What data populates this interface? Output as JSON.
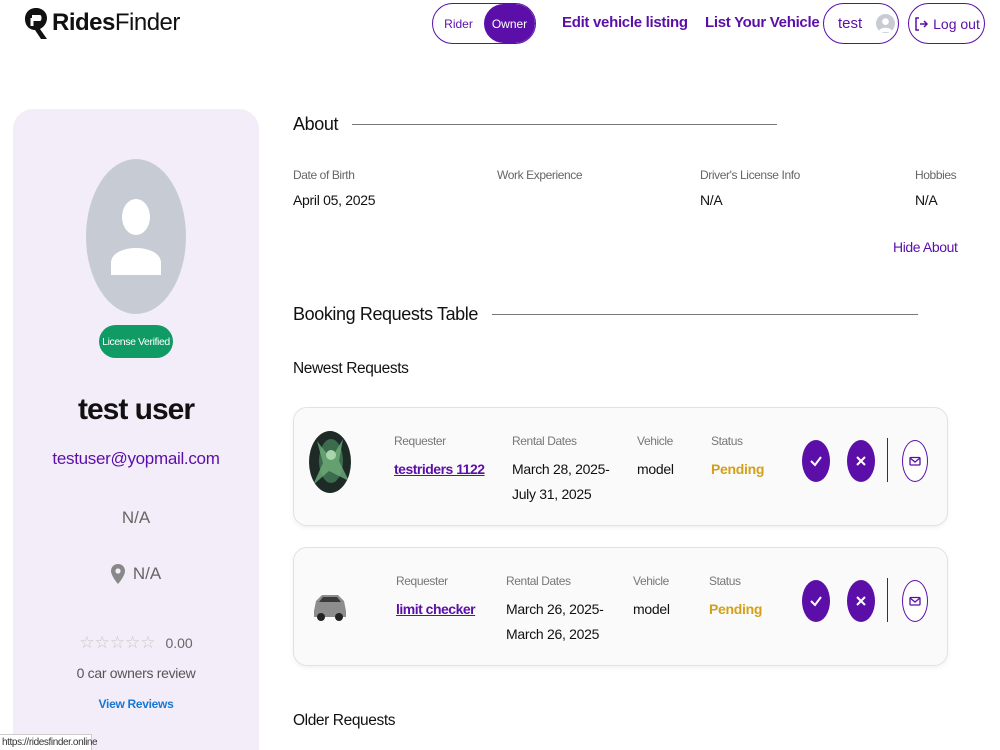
{
  "header": {
    "logo_text_bold": "Rides",
    "logo_text_rest": "Finder",
    "role_toggle": {
      "options": [
        "Rider",
        "Owner"
      ],
      "active": "Owner"
    },
    "nav": {
      "edit_listing": "Edit vehicle listing",
      "list_vehicle": "List Your Vehicle"
    },
    "user_name": "test",
    "logout_label": "Log out"
  },
  "profile": {
    "badge": "License Verified",
    "name": "test user",
    "email": "testuser@yopmail.com",
    "field_value": "N/A",
    "location": "N/A",
    "stars": "☆☆☆☆☆",
    "rating": "0.00",
    "review_count": "0 car owners review",
    "view_reviews": "View Reviews"
  },
  "about": {
    "title": "About",
    "fields": [
      {
        "label": "Date of Birth",
        "value": "April 05, 2025"
      },
      {
        "label": "Work Experience",
        "value": ""
      },
      {
        "label": "Driver's License Info",
        "value": "N/A"
      },
      {
        "label": "Hobbies",
        "value": "N/A"
      }
    ],
    "hide_label": "Hide About"
  },
  "booking": {
    "title": "Booking Requests Table",
    "newest_title": "Newest Requests",
    "older_title": "Older Requests",
    "columns": {
      "requester": "Requester",
      "rental_dates": "Rental Dates",
      "vehicle": "Vehicle",
      "status": "Status"
    },
    "requests": [
      {
        "requester": "testriders 1122",
        "dates_line1": "March 28, 2025-",
        "dates_line2": "July 31, 2025",
        "vehicle": "model",
        "status": "Pending",
        "thumb": "green-creature-photo"
      },
      {
        "requester": "limit checker",
        "dates_line1": "March 26, 2025-",
        "dates_line2": "March 26, 2025",
        "vehicle": "model",
        "status": "Pending",
        "thumb": "suv-car-photo"
      }
    ]
  },
  "browser_status_url": "https://ridesfinder.online",
  "colors": {
    "accent": "#5b0fa8",
    "verified": "#109a64",
    "pending": "#d4a017",
    "link_blue": "#1877d2",
    "card_bg": "#f3edf9"
  },
  "icons": {
    "approve": "check-icon",
    "reject": "x-icon",
    "message": "envelope-icon",
    "logout": "logout-icon",
    "location": "map-pin-icon"
  }
}
